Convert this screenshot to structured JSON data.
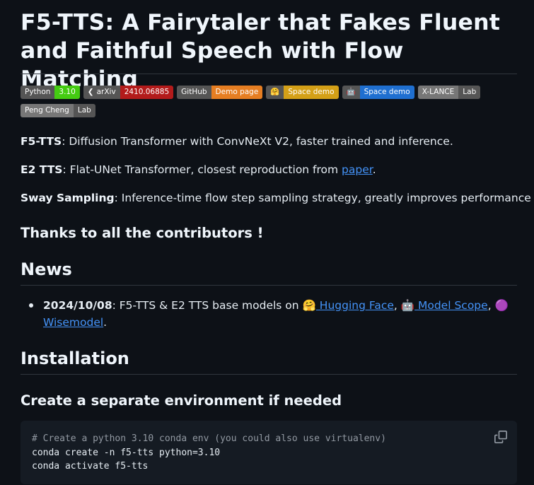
{
  "title": "F5-TTS: A Fairytaler that Fakes Fluent and Faithful Speech with Flow Matching",
  "badges_row1": [
    {
      "left": "Python",
      "right": "3.10",
      "color": "#4c1"
    },
    {
      "left": "arXiv",
      "right": "2410.06885",
      "color": "#b31b1b",
      "icon": "arxiv-icon"
    },
    {
      "left": "GitHub",
      "right": "Demo page",
      "color": "#e67e22"
    },
    {
      "left": "🤗",
      "right": "Space demo",
      "color": "#d4a017"
    },
    {
      "left": "🤖",
      "right": "Space demo",
      "color": "#1f6fd0"
    },
    {
      "left": "X-LANCE",
      "right": "Lab",
      "color": "#555"
    }
  ],
  "badges_row2": [
    {
      "left": "Peng Cheng",
      "right": "Lab",
      "color": "#555"
    }
  ],
  "items": {
    "f5_term": "F5-TTS",
    "f5_desc": ": Diffusion Transformer with ConvNeXt V2, faster trained and inference.",
    "e2_term": "E2 TTS",
    "e2_desc": ": Flat-UNet Transformer, closest reproduction from ",
    "e2_link": "paper",
    "e2_end": ".",
    "sway_term": "Sway Sampling",
    "sway_desc": ": Inference-time flow step sampling strategy, greatly improves performance"
  },
  "thanks": "Thanks to all the contributors !",
  "news": {
    "heading": "News",
    "date": "2024/10/08",
    "text": ": F5-TTS & E2 TTS base models on ",
    "hf_emoji": "🤗",
    "hf_link": " Hugging Face",
    "sep1": ", ",
    "ms_emoji": "🤖",
    "ms_link": " Model Scope",
    "sep2": ", ",
    "wm_emoji": "🟣",
    "wm_link": " Wisemodel",
    "end": "."
  },
  "install": {
    "heading": "Installation",
    "subheading": "Create a separate environment if needed",
    "code_comment": "# Create a python 3.10 conda env (you could also use virtualenv)",
    "code_line1": "conda create -n f5-tts python=3.10",
    "code_line2": "conda activate f5-tts"
  }
}
